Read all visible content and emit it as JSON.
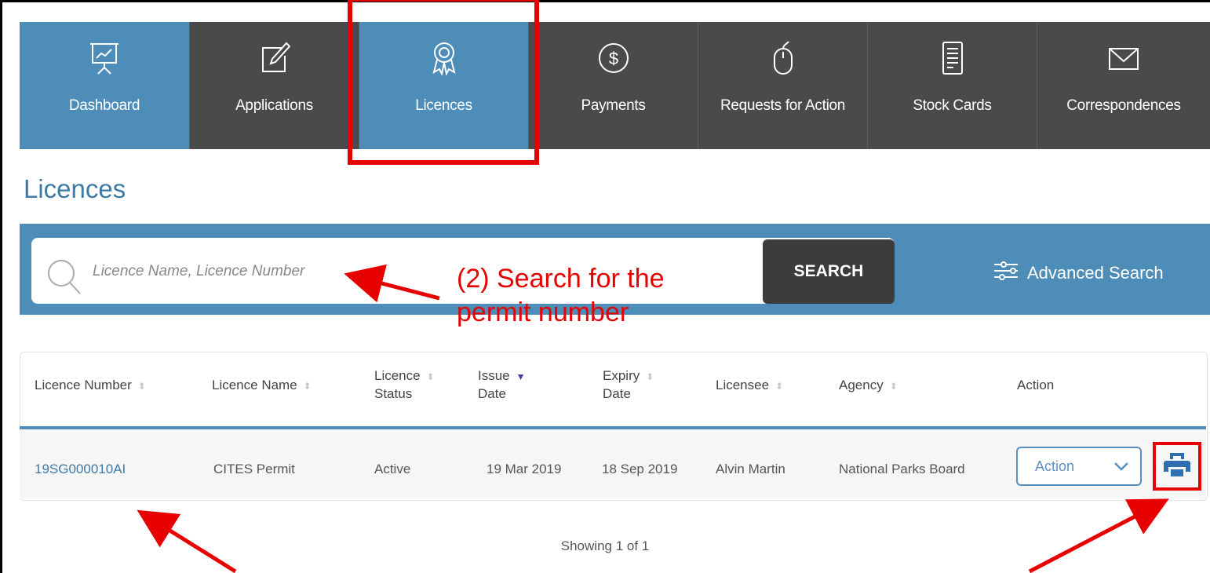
{
  "nav": {
    "tabs": [
      {
        "label": "Dashboard",
        "icon": "presentation-chart-icon",
        "active": true
      },
      {
        "label": "Applications",
        "icon": "edit-icon",
        "active": false
      },
      {
        "label": "Licences",
        "icon": "award-ribbon-icon",
        "active": true
      },
      {
        "label": "Payments",
        "icon": "dollar-circle-icon",
        "active": false
      },
      {
        "label": "Requests for Action",
        "icon": "mouse-icon",
        "active": false
      },
      {
        "label": "Stock Cards",
        "icon": "document-icon",
        "active": false
      },
      {
        "label": "Correspondences",
        "icon": "envelope-icon",
        "active": false
      }
    ]
  },
  "page": {
    "title": "Licences"
  },
  "search": {
    "placeholder": "Licence Name, Licence Number",
    "button_label": "SEARCH",
    "advanced_label": "Advanced Search"
  },
  "annotation": {
    "line1": "(2) Search for the",
    "line2": "permit number"
  },
  "table": {
    "headers": [
      {
        "line1": "Licence Number",
        "line2": ""
      },
      {
        "line1": "Licence Name",
        "line2": ""
      },
      {
        "line1": "Licence",
        "line2": "Status"
      },
      {
        "line1": "Issue",
        "line2": "Date"
      },
      {
        "line1": "Expiry",
        "line2": "Date"
      },
      {
        "line1": "Licensee",
        "line2": ""
      },
      {
        "line1": "Agency",
        "line2": ""
      },
      {
        "line1": "Action",
        "line2": ""
      }
    ],
    "rows": [
      {
        "licence_number": "19SG000010AI",
        "licence_name": "CITES Permit",
        "status": "Active",
        "issue_date": "19 Mar 2019",
        "expiry_date": "18 Sep 2019",
        "licensee": "Alvin Martin",
        "agency": "National Parks Board",
        "action": "Action"
      }
    ]
  },
  "pagination": {
    "text": "Showing 1 of 1"
  },
  "colors": {
    "nav_blue": "#4e8db8",
    "nav_dark": "#4a4a4a",
    "annotation_red": "#e60000"
  }
}
